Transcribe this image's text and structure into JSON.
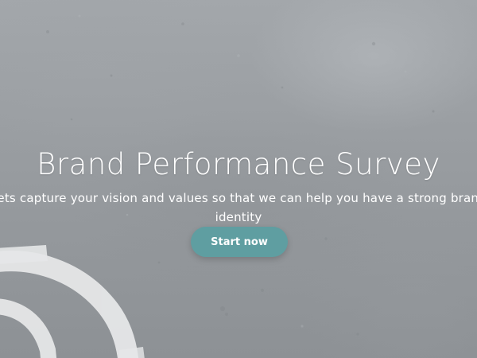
{
  "hero": {
    "title": "Brand Performance Survey",
    "subtitle": "Lets capture your vision and values so that we can help you have a strong brand identity",
    "start_button_label": "Start now",
    "background_image": "grey concrete wall with white painted curves",
    "colors": {
      "button": "#5f9ea1",
      "text": "#ffffff",
      "background": "#9a9ea2"
    }
  }
}
